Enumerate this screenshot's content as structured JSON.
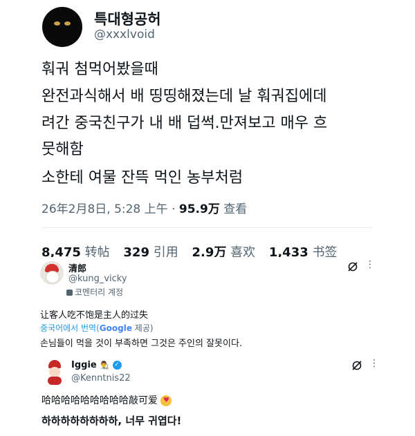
{
  "tweet": {
    "author_name": "특대형공허",
    "author_handle": "@xxxlvoid",
    "lines": [
      "훠궈 첨먹어봤을때",
      "완전과식해서 배 띵띵해졌는데 날 훠궈집에데",
      "려간 중국친구가 내 배 덥썩.만져보고 매우 흐",
      "뭇해함",
      "소한테 여물 잔뜩 먹인 농부처럼"
    ],
    "timestamp": "26年2月8日, 5:28 上午",
    "separator": "·",
    "views_count": "95.9万",
    "views_label": "查看"
  },
  "stats": {
    "retweets_count": "8,475",
    "retweets_label": "转帖",
    "quotes_count": "329",
    "quotes_label": "引用",
    "likes_count": "2.9万",
    "likes_label": "喜欢",
    "bookmarks_count": "1,433",
    "bookmarks_label": "书签"
  },
  "reply1": {
    "name": "清郎",
    "handle": "@kung_vicky",
    "community_note": "코멘터리 계정",
    "text": "让客人吃不饱是主人的过失",
    "translate_prefix": "중국어에서 번역(",
    "translate_provider": "Google",
    "translate_suffix": " 제공)",
    "translation": "손님들이 먹을 것이 부족하면 그것은 주인의 잘못이다."
  },
  "reply2": {
    "name": "Iggie",
    "handle": "@Kenntnis22",
    "text": "哈哈哈哈哈哈哈哈哈敲可爱",
    "translation": "하하하하하하하하, 너무 귀엽다!"
  },
  "colors": {
    "text_primary": "#0f1419",
    "text_secondary": "#536471",
    "verified_blue": "#1d9bf0",
    "translate_blue": "#1d9bf0"
  }
}
